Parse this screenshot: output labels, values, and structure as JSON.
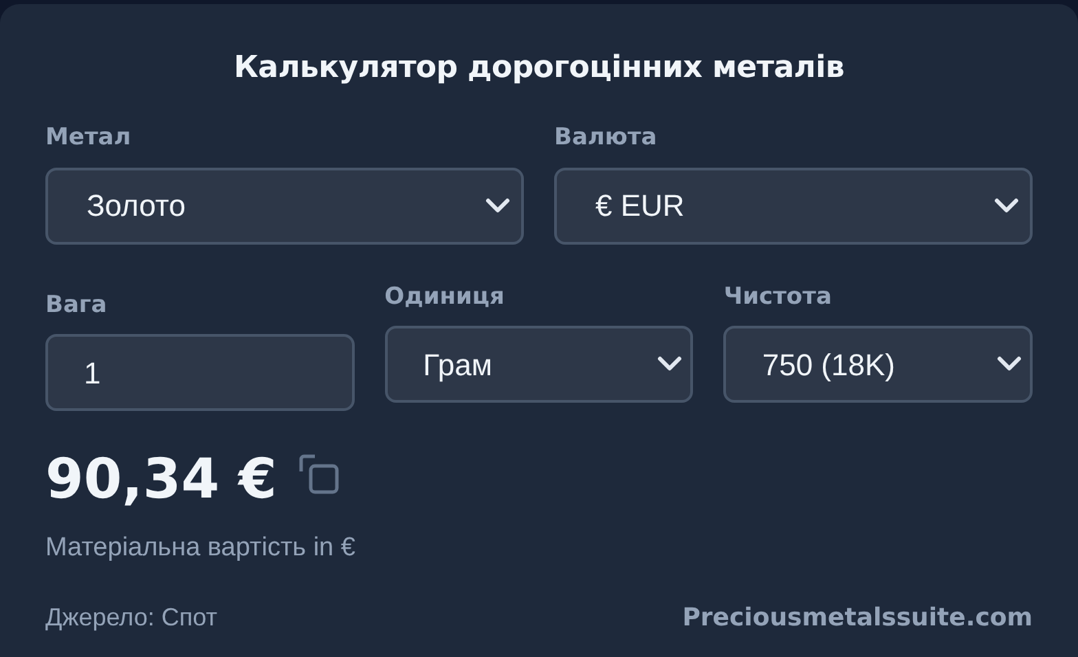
{
  "title": "Калькулятор дорогоцінних металів",
  "rows": [
    [
      {
        "label": "Метал",
        "kind": "select",
        "value": "Золото"
      },
      {
        "label": "Валюта",
        "kind": "select",
        "value": "€ EUR"
      }
    ],
    [
      {
        "label": "Вага",
        "kind": "input",
        "value": "1"
      },
      {
        "label": "Одиниця",
        "kind": "select",
        "value": "Грам"
      },
      {
        "label": "Чистота",
        "kind": "select",
        "value": "750 (18K)"
      }
    ]
  ],
  "result": {
    "value": "90,34 €",
    "caption": "Матеріальна вартість in €"
  },
  "footer": {
    "source": "Джерело: Спот",
    "link": "Preciousmetalssuite.com"
  }
}
